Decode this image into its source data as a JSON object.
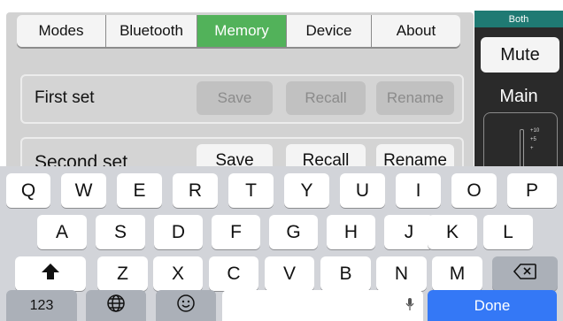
{
  "tabs": [
    "Modes",
    "Bluetooth",
    "Memory",
    "Device",
    "About"
  ],
  "active_tab": "Memory",
  "sets": [
    {
      "label": "First set",
      "save": "Save",
      "recall": "Recall",
      "rename": "Rename"
    },
    {
      "label": "Second set",
      "save": "Save",
      "recall": "Recall",
      "rename": "Rename"
    }
  ],
  "side": {
    "both_label": "Both",
    "mute_label": "Mute",
    "main_label": "Main",
    "meter_ticks": [
      "+10",
      "+5",
      "+"
    ]
  },
  "keyboard": {
    "row1": [
      "Q",
      "W",
      "E",
      "R",
      "T",
      "Y",
      "U",
      "I",
      "O",
      "P"
    ],
    "row2": [
      "A",
      "S",
      "D",
      "F",
      "G",
      "H",
      "J",
      "K",
      "L"
    ],
    "row3": [
      "Z",
      "X",
      "C",
      "V",
      "B",
      "N",
      "M"
    ],
    "numbers_key": "123",
    "done_key": "Done",
    "icons": {
      "shift": "shift-arrow-icon",
      "delete": "backspace-icon",
      "globe": "globe-icon",
      "emoji": "emoji-icon",
      "mic": "microphone-icon"
    }
  },
  "colors": {
    "active_tab": "#52b25a",
    "both_bar": "#1f7a73",
    "done_key": "#3478f6"
  }
}
